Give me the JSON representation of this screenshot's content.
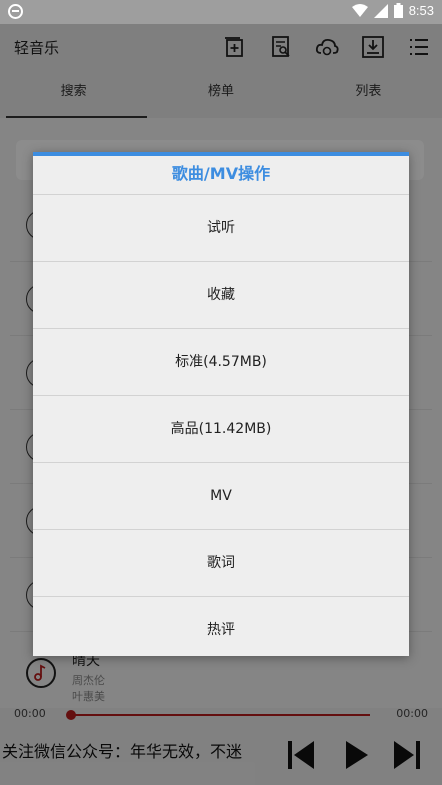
{
  "status_bar": {
    "time": "8:53"
  },
  "app_bar": {
    "title": "轻音乐",
    "icons": [
      "add-playlist-icon",
      "search-document-icon",
      "cloud-sync-icon",
      "download-icon",
      "menu-list-icon"
    ]
  },
  "tabs": [
    {
      "label": "搜索",
      "active": true
    },
    {
      "label": "榜单",
      "active": false
    },
    {
      "label": "列表",
      "active": false
    }
  ],
  "now_playing": {
    "song": "晴天",
    "artist": "周杰伦",
    "artist2": "叶惠美",
    "time_left": "00:00",
    "time_right": "00:00",
    "progress": 0
  },
  "footer": {
    "banner": "关注微信公众号：年华无效，不迷"
  },
  "dialog": {
    "title": "歌曲/MV操作",
    "options": [
      "试听",
      "收藏",
      "标准(4.57MB)",
      "高品(11.42MB)",
      "MV",
      "歌词",
      "热评"
    ]
  },
  "colors": {
    "accent": "#3d8de0",
    "progress": "#b71c1c"
  }
}
